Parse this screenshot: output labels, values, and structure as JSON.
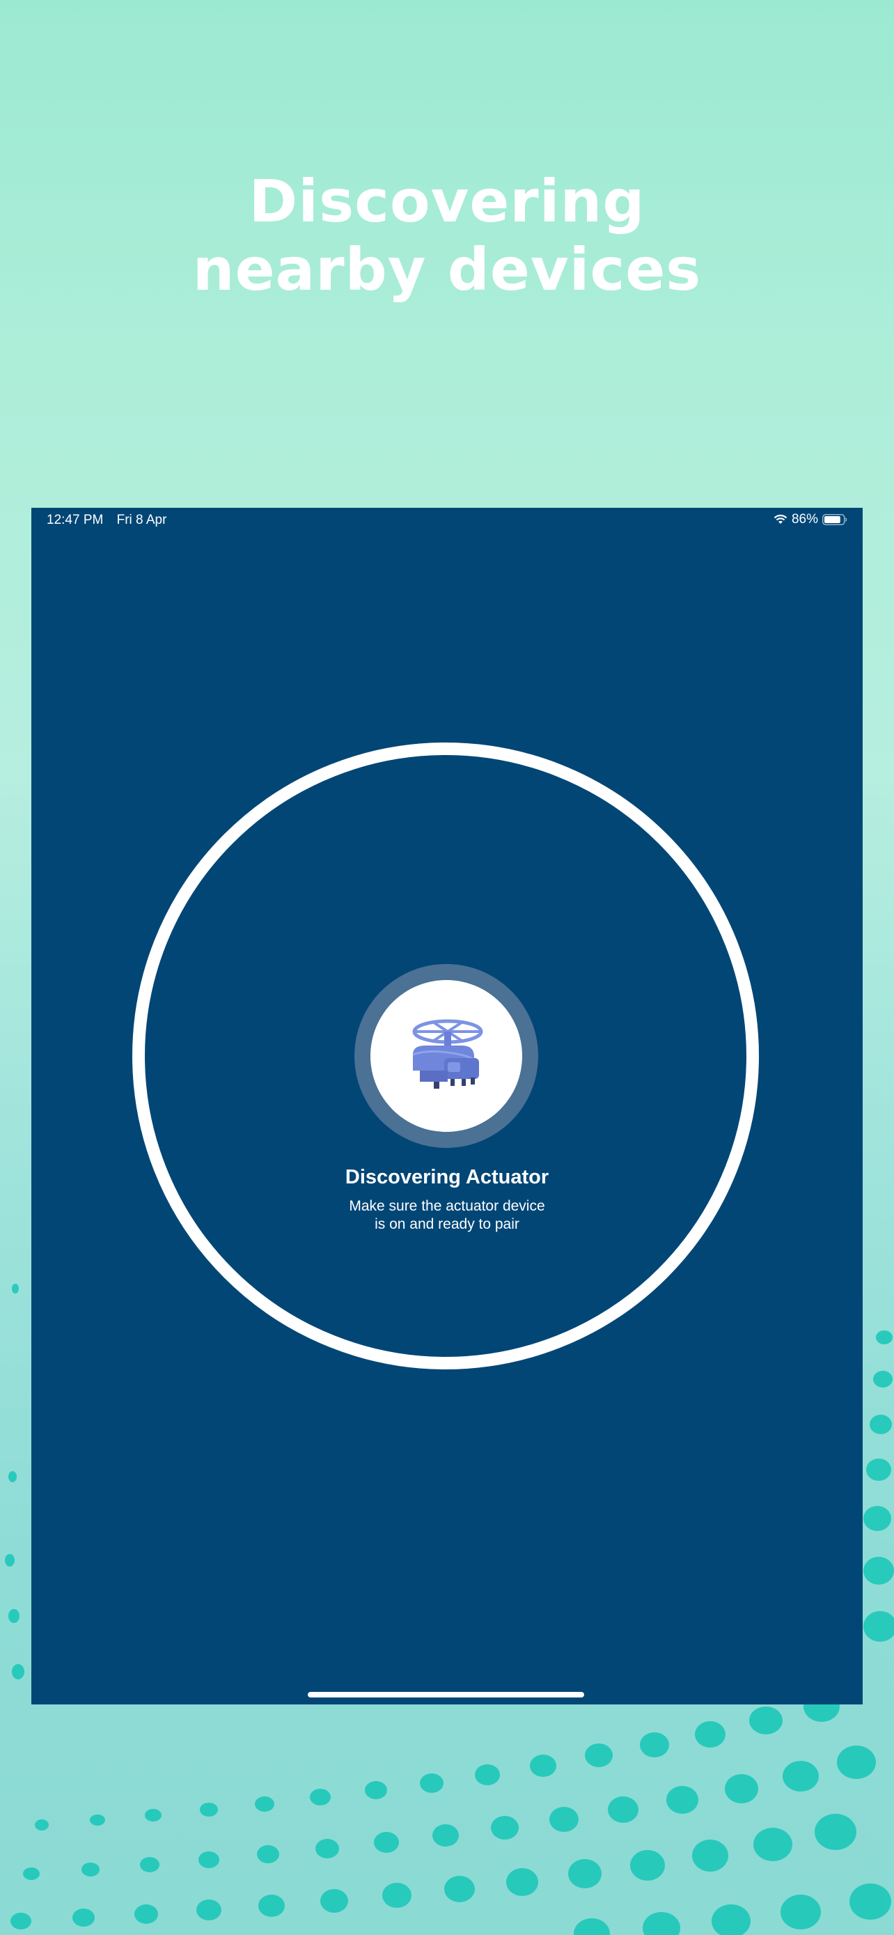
{
  "headline": {
    "line1": "Discovering",
    "line2": "nearby devices"
  },
  "status_bar": {
    "time": "12:47 PM",
    "date": "Fri 8 Apr",
    "battery": "86%",
    "battery_level": 0.86
  },
  "discovery": {
    "title": "Discovering Actuator",
    "subtitle_line1": "Make sure the actuator device",
    "subtitle_line2": "is on and ready to pair",
    "icon": "actuator-device-icon"
  },
  "colors": {
    "app_background": "#024676",
    "ring": "#ffffff",
    "halo": "#4b7194",
    "actuator": "#6f86dc",
    "page_gradient_top": "#9ce9d2",
    "dots": "#12c6b6"
  }
}
